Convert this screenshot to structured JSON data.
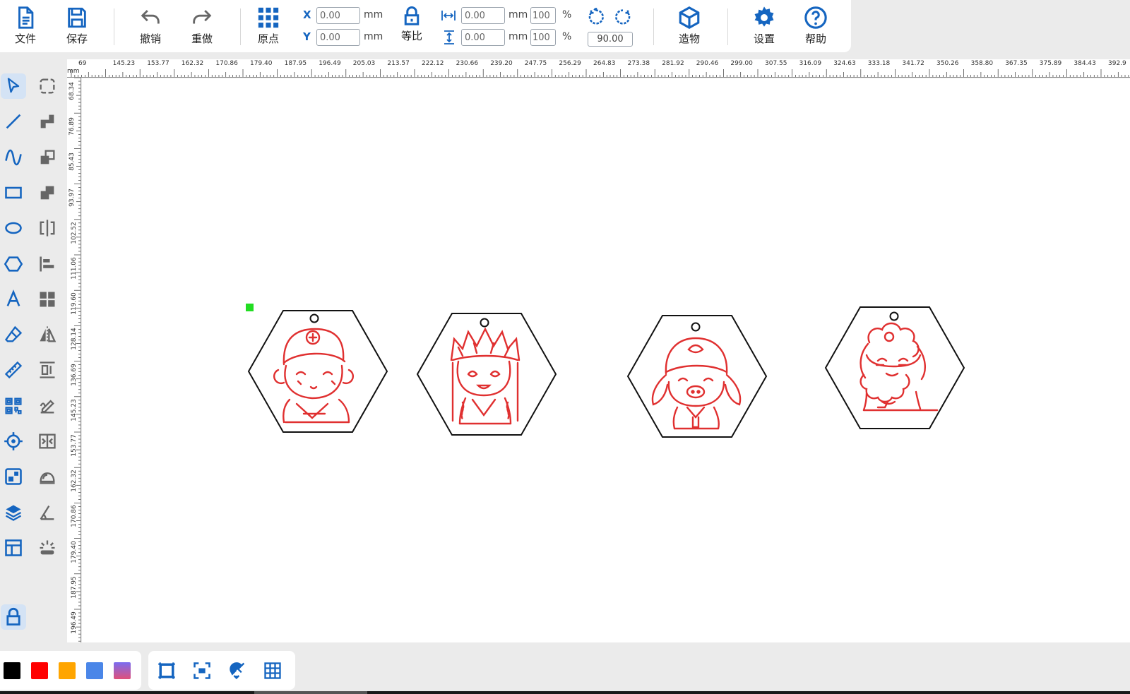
{
  "toolbar": {
    "file_label": "文件",
    "save_label": "保存",
    "undo_label": "撤销",
    "redo_label": "重做",
    "origin_label": "原点",
    "x_label": "X",
    "y_label": "Y",
    "x_value": "0.00",
    "y_value": "0.00",
    "unit_mm": "mm",
    "lock_ratio_label": "等比",
    "width_value": "0.00",
    "height_value": "0.00",
    "width_percent": "100",
    "height_percent": "100",
    "percent_sign": "%",
    "rotation_value": "90.00",
    "build_label": "造物",
    "settings_label": "设置",
    "help_label": "帮助",
    "accent_color": "#1565c0"
  },
  "ruler": {
    "unit": "mm",
    "top_labels": [
      "69",
      "145.23",
      "153.77",
      "162.32",
      "170.86",
      "179.40",
      "187.95",
      "196.49",
      "205.03",
      "213.57",
      "222.12",
      "230.66",
      "239.20",
      "247.75",
      "256.29",
      "264.83",
      "273.38",
      "281.92",
      "290.46",
      "299.00",
      "307.55",
      "316.09",
      "324.63",
      "333.18",
      "341.72",
      "350.26",
      "358.80",
      "367.35",
      "375.89",
      "384.43",
      "392.9"
    ],
    "left_labels": [
      "68.34",
      "76.89",
      "85.43",
      "93.97",
      "102.52",
      "111.06",
      "119.60",
      "128.14",
      "136.69",
      "145.23",
      "153.77",
      "162.32",
      "170.86",
      "179.40",
      "187.95",
      "196.49"
    ]
  },
  "left_tools": [
    {
      "name": "select-tool",
      "icon": "cursor"
    },
    {
      "name": "node-edit-tool",
      "icon": "dashed-rect"
    },
    {
      "name": "line-tool",
      "icon": "line"
    },
    {
      "name": "boolean-union-tool",
      "icon": "union"
    },
    {
      "name": "curve-tool",
      "icon": "curve"
    },
    {
      "name": "boolean-subtract-tool",
      "icon": "subtract"
    },
    {
      "name": "rectangle-tool",
      "icon": "rect"
    },
    {
      "name": "boolean-intersect-tool",
      "icon": "intersect"
    },
    {
      "name": "ellipse-tool",
      "icon": "ellipse"
    },
    {
      "name": "mirror-tool",
      "icon": "mirror"
    },
    {
      "name": "polygon-tool",
      "icon": "hexagon"
    },
    {
      "name": "align-tool",
      "icon": "align"
    },
    {
      "name": "text-tool",
      "icon": "text"
    },
    {
      "name": "array-tool",
      "icon": "grid"
    },
    {
      "name": "eraser-tool",
      "icon": "eraser"
    },
    {
      "name": "flip-tool",
      "icon": "flip"
    },
    {
      "name": "measure-tool",
      "icon": "ruler"
    },
    {
      "name": "distribute-tool",
      "icon": "distribute"
    },
    {
      "name": "qrcode-tool",
      "icon": "qrcode"
    },
    {
      "name": "sign-tool",
      "icon": "sign"
    },
    {
      "name": "position-tool",
      "icon": "target"
    },
    {
      "name": "split-tool",
      "icon": "split"
    },
    {
      "name": "image-tool",
      "icon": "image"
    },
    {
      "name": "offset-tool",
      "icon": "offset"
    },
    {
      "name": "layers-tool",
      "icon": "layers"
    },
    {
      "name": "angle-tool",
      "icon": "angle"
    },
    {
      "name": "template-tool",
      "icon": "template"
    },
    {
      "name": "light-tool",
      "icon": "light"
    },
    {
      "name": "lock-tool",
      "icon": "lock"
    }
  ],
  "colors": [
    "#000000",
    "#ff0000",
    "#ffa500",
    "#4a86e8",
    "#e060a0"
  ],
  "view_tools": [
    {
      "name": "fit-frame-button",
      "icon": "frame"
    },
    {
      "name": "fit-selection-button",
      "icon": "focus"
    },
    {
      "name": "magnet-button",
      "icon": "magnet"
    },
    {
      "name": "grid-button",
      "icon": "grid"
    }
  ],
  "canvas_objects": [
    {
      "name": "keychain-monkey",
      "character": "monkey",
      "stroke": "#e03030"
    },
    {
      "name": "keychain-monk",
      "character": "monk",
      "stroke": "#e03030"
    },
    {
      "name": "keychain-pig",
      "character": "pig",
      "stroke": "#e03030"
    },
    {
      "name": "keychain-sandy",
      "character": "sandy",
      "stroke": "#e03030"
    }
  ],
  "selection_handle_color": "#22dd22"
}
